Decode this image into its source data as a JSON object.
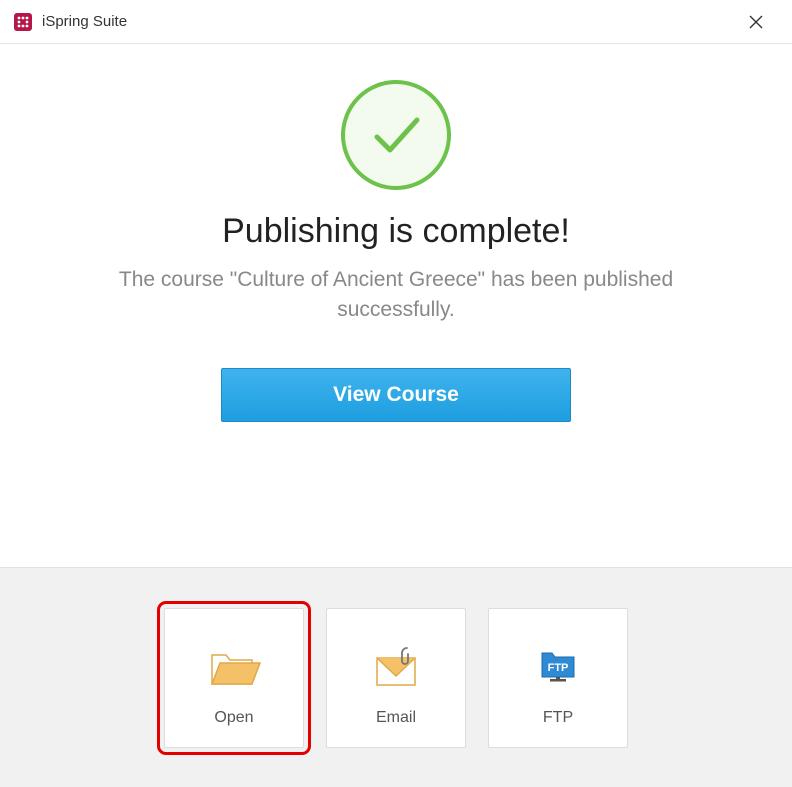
{
  "titlebar": {
    "app_title": "iSpring Suite",
    "close_glyph": "✕"
  },
  "main": {
    "heading": "Publishing is complete!",
    "subtext": "The course \"Culture of Ancient Greece\" has been published successfully.",
    "view_button_label": "View Course"
  },
  "actions": {
    "open_label": "Open",
    "email_label": "Email",
    "ftp_label": "FTP"
  }
}
